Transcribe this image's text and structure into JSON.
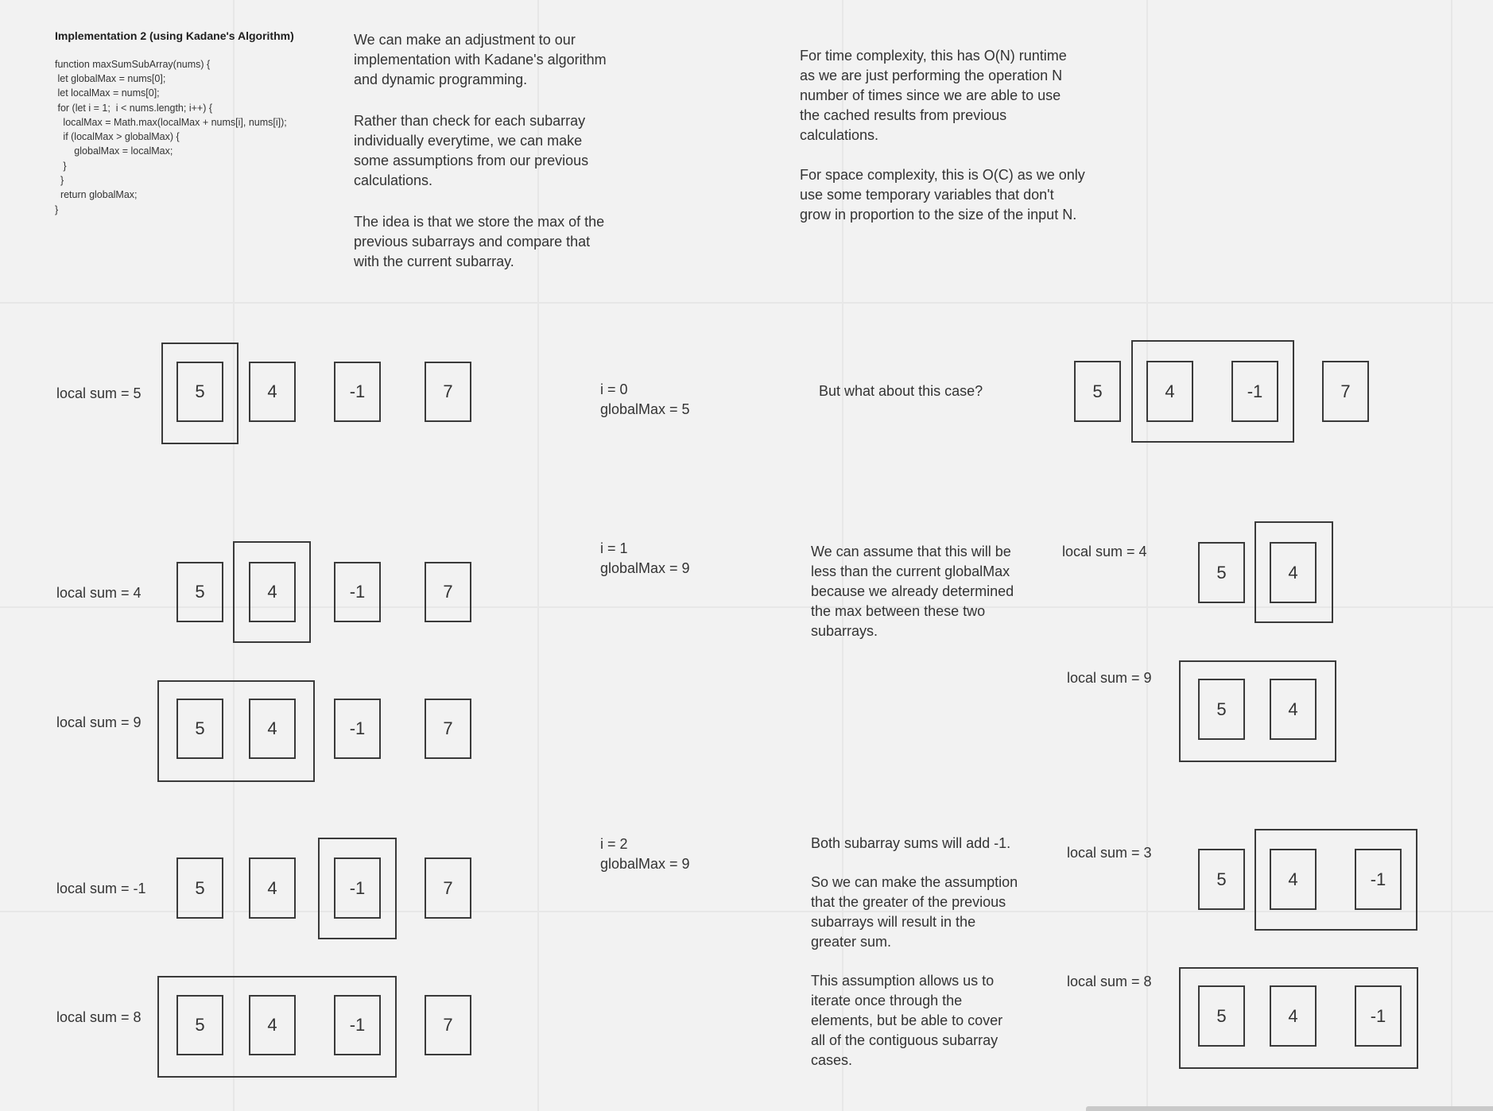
{
  "code": {
    "title": "Implementation 2 (using Kadane's Algorithm)",
    "lines": [
      "function maxSumSubArray(nums) {",
      " let globalMax = nums[0];",
      " let localMax = nums[0];",
      " for (let i = 1;  i < nums.length; i++) {",
      "   localMax = Math.max(localMax + nums[i], nums[i]);",
      "   if (localMax > globalMax) {",
      "       globalMax = localMax;",
      "   }",
      "  }",
      "  return globalMax;",
      "}"
    ]
  },
  "intro": {
    "p1": "We can make an adjustment to our\nimplementation with Kadane's algorithm\nand dynamic programming.",
    "p2": "Rather than check for each subarray\nindividually everytime, we can make\nsome assumptions from our previous\ncalculations.",
    "p3": "The idea is that we store the max of the\nprevious subarrays and compare that\nwith the current subarray."
  },
  "complexity": {
    "time": "For time complexity, this has O(N) runtime\nas we are just performing the operation N\nnumber of times since we are able to use\nthe cached results from previous\ncalculations.",
    "space": "For space complexity, this is O(C) as we only\nuse some temporary variables that don't\ngrow in proportion to the size of the input N."
  },
  "array": [
    "5",
    "4",
    "-1",
    "7"
  ],
  "steps": {
    "s0": {
      "local": "local sum = 5",
      "i": "i = 0",
      "global": "globalMax = 5"
    },
    "s1a": {
      "local": "local sum = 4",
      "i": "i = 1",
      "global": "globalMax = 9"
    },
    "s1b": {
      "local": "local sum = 9"
    },
    "s2a": {
      "local": "local sum = -1",
      "i": "i = 2",
      "global": "globalMax = 9"
    },
    "s2b": {
      "local": "local sum = 8"
    }
  },
  "right": {
    "question": "But what about this case?",
    "assume": "We can assume that this will be\nless than the current globalMax\nbecause we already determined\nthe max between these two\nsubarrays.",
    "both_p1": "Both subarray sums will add -1.",
    "both_p2": "So we can make the assumption\nthat the greater of the previous\nsubarrays will result in the\ngreater sum.",
    "both_p3": "This assumption allows us to\niterate once through the\nelements, but be able to cover\nall of the contiguous subarray\ncases.",
    "r1_local": "local sum = 4",
    "r2_local": "local sum = 9",
    "r3_local": "local sum = 3",
    "r4_local": "local sum = 8"
  }
}
